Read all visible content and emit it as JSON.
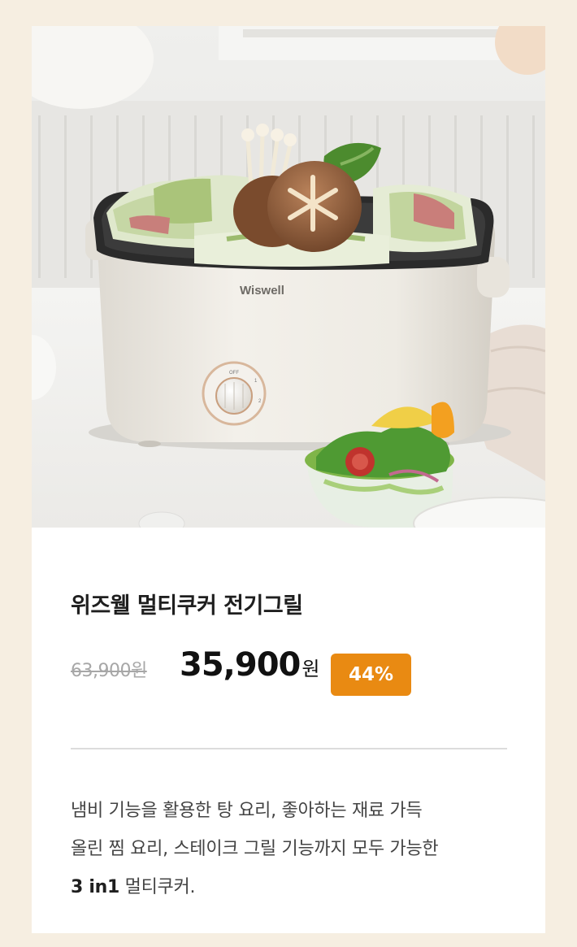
{
  "product": {
    "title": "위즈웰 멀티쿠커 전기그릴",
    "original_price": "63,900원",
    "sale_price": "35,900",
    "sale_price_unit": "원",
    "discount": "44%",
    "image": {
      "brand_on_product": "Wiswell",
      "dial_labels": [
        "OFF",
        "1",
        "2"
      ]
    },
    "description": {
      "line1": "냄비 기능을 활용한 탕 요리, 좋아하는 재료 가득",
      "line2": "올린 찜 요리, 스테이크 그릴 기능까지 모두 가능한",
      "line3_bold": "3 in1",
      "line3_rest": " 멀티쿠커."
    }
  },
  "colors": {
    "page_background": "#f6eee1",
    "card_background": "#ffffff",
    "discount_badge": "#e98a12",
    "divider": "#dcdcdc"
  }
}
